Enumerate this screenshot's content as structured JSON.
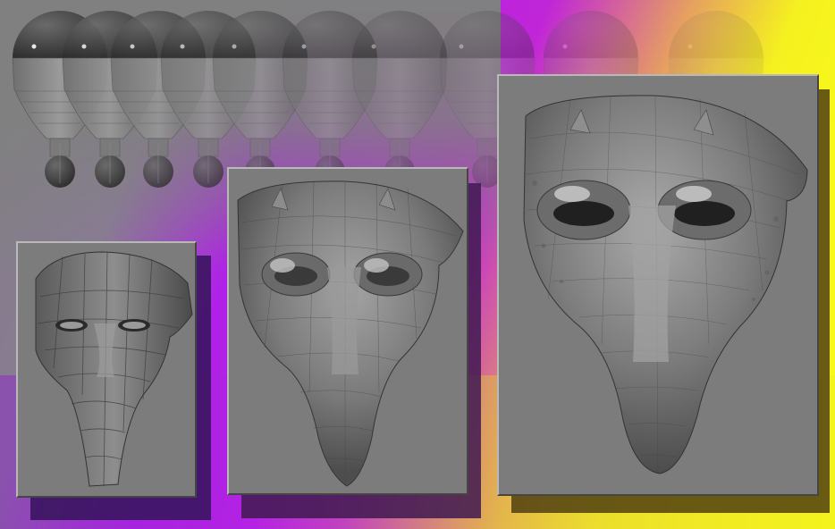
{
  "image": {
    "subject": "mask-sculpt-progression",
    "palette": {
      "gray": "#7f7f7f",
      "magenta": "#b81ef0",
      "yellow": "#f2f21a",
      "panel": "#7c7c7c",
      "panel_shadow": "#2c1e3a"
    },
    "sequence_steps": 10,
    "panels": [
      {
        "stage": "base-mesh",
        "detail_level": 1
      },
      {
        "stage": "mid-detail",
        "detail_level": 2
      },
      {
        "stage": "high-detail",
        "detail_level": 3
      }
    ]
  }
}
